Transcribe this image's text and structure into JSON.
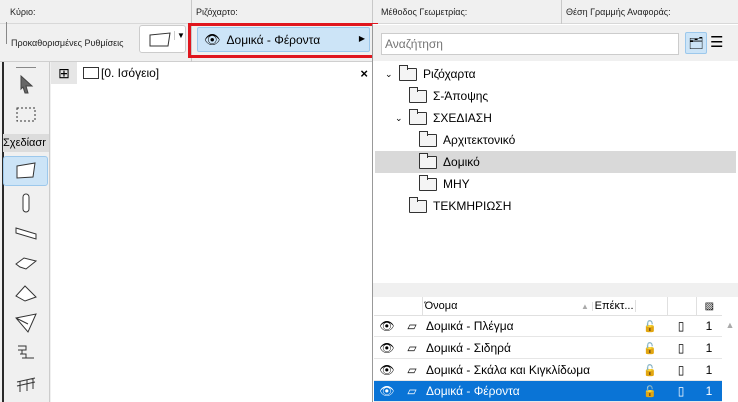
{
  "toolbar": {
    "main_label": "Κύριο:",
    "presets_label": "Προκαθορισμένες Ρυθμίσεις",
    "layer_label": "Ριζόχαρτο:",
    "geometry_label": "Μέθοδος Γεωμετρίας:",
    "refline_label": "Θέση Γραμμής Αναφοράς:",
    "layer_value": "Δομικά - Φέροντα"
  },
  "canvas": {
    "tab_label": "[0. Ισόγειο]",
    "close": "×"
  },
  "toolbox": {
    "group_label": "Σχεδίασr"
  },
  "panel": {
    "search_placeholder": "Αναζήτηση",
    "tree": [
      {
        "label": "Ριζόχαρτα",
        "level": 0,
        "expanded": true
      },
      {
        "label": "Σ-Άποψης",
        "level": 1
      },
      {
        "label": "ΣΧΕΔΙΑΣΗ",
        "level": 1,
        "expanded": true
      },
      {
        "label": "Αρχιτεκτονικό",
        "level": 2
      },
      {
        "label": "Δομικό",
        "level": 2,
        "selected": true
      },
      {
        "label": "ΜΗΥ",
        "level": 2
      },
      {
        "label": "ΤΕΚΜΗΡΙΩΣΗ",
        "level": 1
      }
    ],
    "table": {
      "col_name": "Όνομα",
      "col_ext": "Επέκτ...",
      "rows": [
        {
          "name": "Δομικά - Πλέγμα",
          "num": "1"
        },
        {
          "name": "Δομικά - Σιδηρά",
          "num": "1"
        },
        {
          "name": "Δομικά - Σκάλα και Κιγκλίδωμα",
          "num": "1"
        },
        {
          "name": "Δομικά - Φέροντα",
          "num": "1",
          "selected": true
        }
      ]
    }
  },
  "colors": {
    "highlight": "#e0161e",
    "selection": "#0a74d6",
    "layer_bg": "#cce4f7"
  }
}
